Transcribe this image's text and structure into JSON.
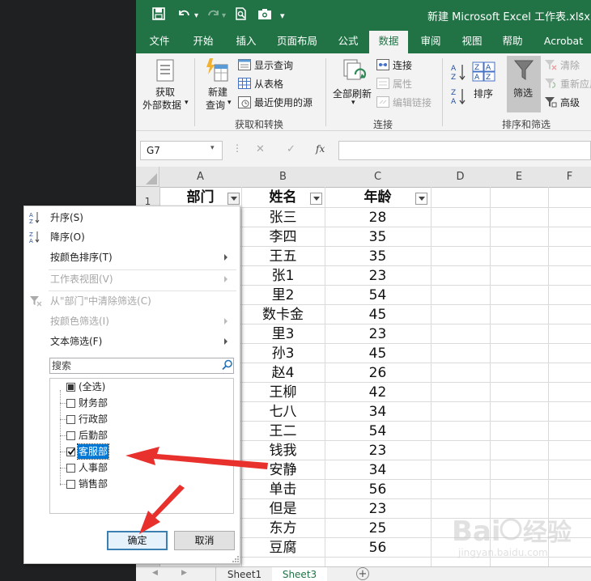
{
  "window": {
    "title": "新建 Microsoft Excel 工作表.xlsx",
    "minimize": "-"
  },
  "tabs": [
    "文件",
    "开始",
    "插入",
    "页面布局",
    "公式",
    "数据",
    "审阅",
    "视图",
    "帮助",
    "Acrobat"
  ],
  "active_tab": "数据",
  "ribbon": {
    "get_external_data": [
      "获取",
      "外部数据"
    ],
    "new_query": [
      "新建",
      "查询"
    ],
    "show_queries": "显示查询",
    "from_table": "从表格",
    "recent_sources": "最近使用的源",
    "group_get_transform": "获取和转换",
    "refresh_all": "全部刷新",
    "connections": "连接",
    "properties": "属性",
    "edit_links": "编辑链接",
    "group_connections": "连接",
    "sort_az": "A↓Z",
    "sort_za": "Z↓A",
    "sort": "排序",
    "filter": "筛选",
    "clear": "清除",
    "reapply": "重新应用",
    "advanced": "高级",
    "group_sort_filter": "排序和筛选"
  },
  "formula_bar": {
    "name_box": "G7",
    "fx": "fx",
    "cancel": "✕",
    "enter": "✓"
  },
  "columns": [
    "A",
    "B",
    "C",
    "D",
    "E",
    "F"
  ],
  "header_row": {
    "row_number": "1",
    "dept": "部门",
    "name": "姓名",
    "age": "年龄"
  },
  "rows": [
    {
      "name": "张三",
      "age": "28"
    },
    {
      "name": "李四",
      "age": "35"
    },
    {
      "name": "王五",
      "age": "35"
    },
    {
      "name": "张1",
      "age": "23"
    },
    {
      "name": "里2",
      "age": "54"
    },
    {
      "name": "数卡金",
      "age": "45"
    },
    {
      "name": "里3",
      "age": "23"
    },
    {
      "name": "孙3",
      "age": "45"
    },
    {
      "name": "赵4",
      "age": "26"
    },
    {
      "name": "王柳",
      "age": "42"
    },
    {
      "name": "七八",
      "age": "34"
    },
    {
      "name": "王二",
      "age": "54"
    },
    {
      "name": "钱我",
      "age": "23"
    },
    {
      "name": "安静",
      "age": "34"
    },
    {
      "name": "单击",
      "age": "56"
    },
    {
      "name": "但是",
      "age": "23"
    },
    {
      "name": "东方",
      "age": "25"
    },
    {
      "name": "豆腐",
      "age": "56"
    }
  ],
  "sheets": [
    "Sheet1",
    "Sheet3"
  ],
  "active_sheet": "Sheet3",
  "add_sheet": "+",
  "filter_menu": {
    "sort_asc": "升序(S)",
    "sort_desc": "降序(O)",
    "sort_by_color": "按颜色排序(T)",
    "sheet_view": "工作表视图(V)",
    "clear_filter": "从\"部门\"中清除筛选(C)",
    "filter_by_color": "按颜色筛选(I)",
    "text_filters": "文本筛选(F)",
    "search_placeholder": "搜索",
    "items": [
      {
        "label": "(全选)",
        "state": "partial"
      },
      {
        "label": "财务部",
        "state": "unchecked"
      },
      {
        "label": "行政部",
        "state": "unchecked"
      },
      {
        "label": "后勤部",
        "state": "unchecked"
      },
      {
        "label": "客服部",
        "state": "checked"
      },
      {
        "label": "人事部",
        "state": "unchecked"
      },
      {
        "label": "销售部",
        "state": "unchecked"
      }
    ],
    "ok": "确定",
    "cancel": "取消"
  },
  "watermark": "Baidu经验 jingyan.baidu.com",
  "colors": {
    "excel_green": "#217346",
    "arrow_red": "#e8302c",
    "selection_blue": "#0078d7"
  }
}
